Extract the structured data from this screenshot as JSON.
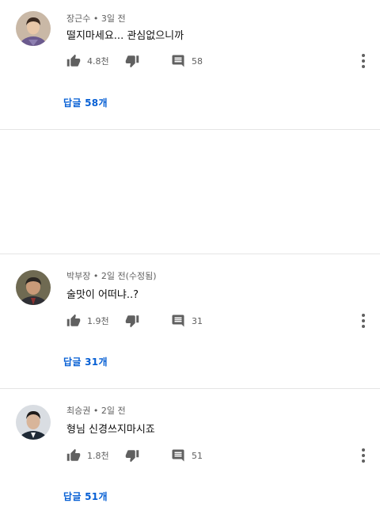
{
  "comments": [
    {
      "author": "장근수",
      "time": "3일 전",
      "text": "떨지마세요... 관심없으니까",
      "likes": "4.8천",
      "replies_count": "58",
      "replies_label": "답글 58개",
      "avatar_colors": {
        "bg": "#c9b8a6",
        "skin": "#e8c7a8",
        "hair": "#3b2a20",
        "shirt": "#6b5a8e"
      }
    },
    {
      "author": "박부장",
      "time": "2일 전(수정됨)",
      "text": "술맛이 어떠냐..?",
      "likes": "1.9천",
      "replies_count": "31",
      "replies_label": "답글 31개",
      "avatar_colors": {
        "bg": "#6f6a52",
        "skin": "#c99a78",
        "hair": "#2a2622",
        "shirt": "#2f2f35"
      }
    },
    {
      "author": "최승권",
      "time": "2일 전",
      "text": "형님 신경쓰지마시죠",
      "likes": "1.8천",
      "replies_count": "51",
      "replies_label": "답글 51개",
      "avatar_colors": {
        "bg": "#d9dde2",
        "skin": "#d8b59a",
        "hair": "#1e1b1a",
        "shirt": "#1f2a36"
      }
    }
  ],
  "separator": "•",
  "icons": {
    "like": "thumb-up-icon",
    "dislike": "thumb-down-icon",
    "reply": "comment-icon",
    "more": "more-vertical-icon"
  },
  "colors": {
    "reply_link": "#065fd4",
    "icon": "#606060",
    "meta_text": "#606060",
    "divider": "#e5e5e5"
  }
}
